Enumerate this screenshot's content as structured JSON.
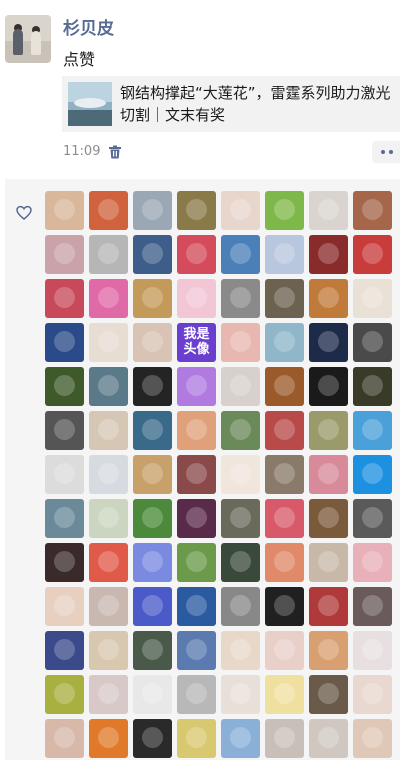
{
  "post": {
    "username": "杉贝皮",
    "action": "点赞",
    "link_title": "钢结构撑起“大莲花”，雷霆系列助力激光切割｜文末有奖",
    "time": "11:09"
  },
  "icons": {
    "delete": "trash-icon",
    "more": "more-dots-icon",
    "like": "heart-outline-icon"
  },
  "colors": {
    "username": "#586b94",
    "likes_background": "#f5f5f5",
    "link_card_background": "#f2f2f2"
  },
  "likers": [
    {
      "bg": "#d9b79a"
    },
    {
      "bg": "#d0633d"
    },
    {
      "bg": "#9aa7b5"
    },
    {
      "bg": "#8a7a4a"
    },
    {
      "bg": "#e8d6cc"
    },
    {
      "bg": "#7fb84a"
    },
    {
      "bg": "#d9d4cf"
    },
    {
      "bg": "#a5664a"
    },
    {
      "bg": "#caa3a8"
    },
    {
      "bg": "#b6b6b6"
    },
    {
      "bg": "#3d5e8a"
    },
    {
      "bg": "#d44b5c"
    },
    {
      "bg": "#4b7fb8"
    },
    {
      "bg": "#b8c6de"
    },
    {
      "bg": "#8a2b2b"
    },
    {
      "bg": "#c93c3c"
    },
    {
      "bg": "#c84a5a"
    },
    {
      "bg": "#e06aa8"
    },
    {
      "bg": "#c49a5a"
    },
    {
      "bg": "#f3c6d6"
    },
    {
      "bg": "#8a8a8a"
    },
    {
      "bg": "#6b6250"
    },
    {
      "bg": "#c07a3a"
    },
    {
      "bg": "#eae1d6"
    },
    {
      "bg": "#2a4a8a"
    },
    {
      "bg": "#e7ddd2"
    },
    {
      "bg": "#d8c3b4"
    },
    {
      "bg": "#6a3fd0",
      "text": "我是\n头像"
    },
    {
      "bg": "#e8b8b0"
    },
    {
      "bg": "#8fb6c9"
    },
    {
      "bg": "#1d2a4a"
    },
    {
      "bg": "#4a4a4a"
    },
    {
      "bg": "#3e5a2a"
    },
    {
      "bg": "#5a7a8a"
    },
    {
      "bg": "#242424"
    },
    {
      "bg": "#b07ae0"
    },
    {
      "bg": "#d8d0cc"
    },
    {
      "bg": "#9a5a2a"
    },
    {
      "bg": "#1a1a1a"
    },
    {
      "bg": "#3a3a28"
    },
    {
      "bg": "#555555"
    },
    {
      "bg": "#d6c7b5"
    },
    {
      "bg": "#3a6a8a"
    },
    {
      "bg": "#e0a07a"
    },
    {
      "bg": "#6a8a5a"
    },
    {
      "bg": "#b84a4a"
    },
    {
      "bg": "#9a9a6a"
    },
    {
      "bg": "#4aa0d8"
    },
    {
      "bg": "#dcdcdc"
    },
    {
      "bg": "#d6dbe2"
    },
    {
      "bg": "#c8a06a"
    },
    {
      "bg": "#8a4a4a"
    },
    {
      "bg": "#f0e6dc"
    },
    {
      "bg": "#8a7a6a"
    },
    {
      "bg": "#d88a9a"
    },
    {
      "bg": "#1e90e0"
    },
    {
      "bg": "#6a8a9a"
    },
    {
      "bg": "#cbd5c0"
    },
    {
      "bg": "#4a8a3a"
    },
    {
      "bg": "#5a2a4a"
    },
    {
      "bg": "#6a6a5a"
    },
    {
      "bg": "#d85a6a"
    },
    {
      "bg": "#7a5a3a"
    },
    {
      "bg": "#5a5a5a"
    },
    {
      "bg": "#3a2a2a"
    },
    {
      "bg": "#e05a4a"
    },
    {
      "bg": "#7a8ae0"
    },
    {
      "bg": "#6a9a4a"
    },
    {
      "bg": "#3a4a3a"
    },
    {
      "bg": "#e08a6a"
    },
    {
      "bg": "#c8b8a8"
    },
    {
      "bg": "#e8b0b8"
    },
    {
      "bg": "#e8d0c0"
    },
    {
      "bg": "#c8b8b0"
    },
    {
      "bg": "#4a5ac8"
    },
    {
      "bg": "#2a5aa0"
    },
    {
      "bg": "#888888"
    },
    {
      "bg": "#202020"
    },
    {
      "bg": "#b03a3a"
    },
    {
      "bg": "#6a5a5a"
    },
    {
      "bg": "#3a4a8a"
    },
    {
      "bg": "#d8c8b0"
    },
    {
      "bg": "#4a5a4a"
    },
    {
      "bg": "#5a7ab0"
    },
    {
      "bg": "#e8d8c8"
    },
    {
      "bg": "#e8d0c8"
    },
    {
      "bg": "#d8a070"
    },
    {
      "bg": "#e8e0e0"
    },
    {
      "bg": "#a8b040"
    },
    {
      "bg": "#d8c8c8"
    },
    {
      "bg": "#e8e8e8"
    },
    {
      "bg": "#b8b8b8"
    },
    {
      "bg": "#e8e0d8"
    },
    {
      "bg": "#f0e0a0"
    },
    {
      "bg": "#6a5a4a"
    },
    {
      "bg": "#e8d8d0"
    },
    {
      "bg": "#d8b8a8"
    },
    {
      "bg": "#e07a2a"
    },
    {
      "bg": "#2a2a2a"
    },
    {
      "bg": "#d8c870"
    },
    {
      "bg": "#8ab0d8"
    },
    {
      "bg": "#c8c0b8"
    },
    {
      "bg": "#d0c8c0"
    },
    {
      "bg": "#e0c8b8"
    }
  ]
}
